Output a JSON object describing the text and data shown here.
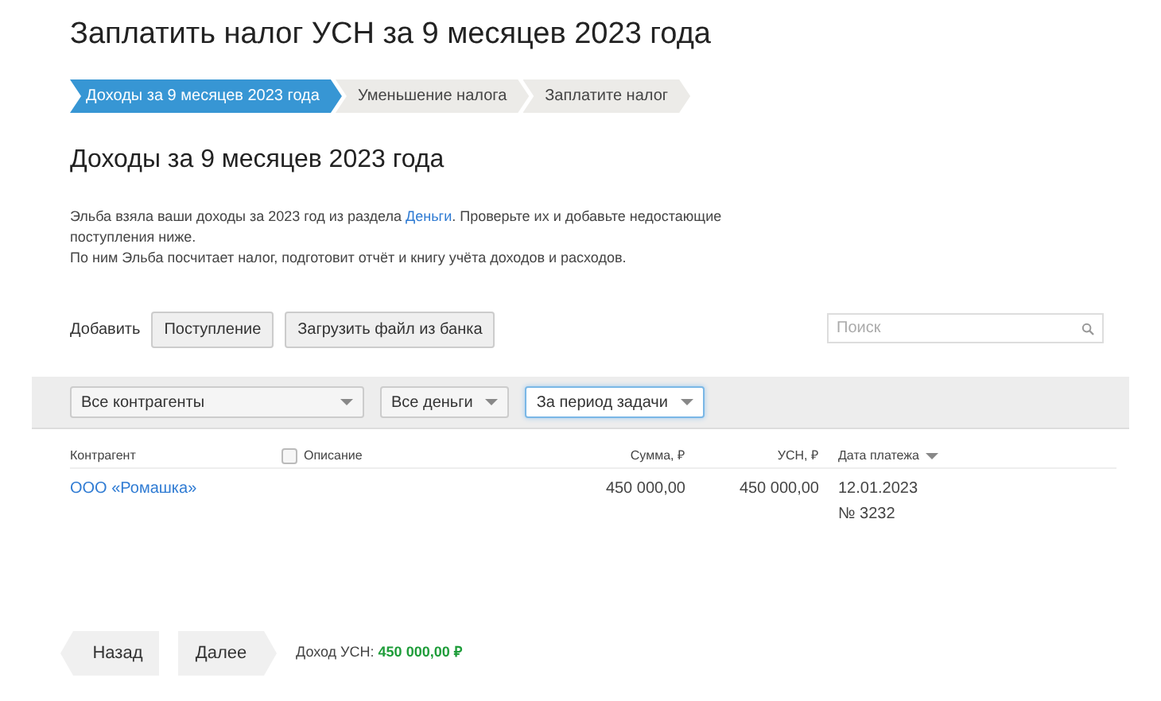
{
  "title": "Заплатить налог УСН за 9 месяцев 2023 года",
  "steps": [
    {
      "label": "Доходы за 9 месяцев 2023 года",
      "selected": true
    },
    {
      "label": "Уменьшение налога",
      "selected": false
    },
    {
      "label": "Заплатите налог",
      "selected": false
    }
  ],
  "section_title": "Доходы за 9 месяцев 2023 года",
  "intro": {
    "before_link": "Эльба взяла ваши доходы за 2023 год из раздела ",
    "link": "Деньги",
    "after_link": ". Проверьте их и добавьте недостающие поступления ниже.",
    "second_line": "По ним Эльба посчитает налог, подготовит отчёт и книгу учёта доходов и расходов."
  },
  "toolbar": {
    "label": "Добавить",
    "buttons": [
      "Поступление",
      "Загрузить файл из банка"
    ],
    "search": {
      "placeholder": "Поиск"
    }
  },
  "filters": [
    {
      "value": "Все контрагенты",
      "focused": false
    },
    {
      "value": "Все деньги",
      "focused": false
    },
    {
      "value": "За период задачи",
      "focused": true
    }
  ],
  "table": {
    "columns": [
      {
        "label": "Контрагент",
        "kind": "text"
      },
      {
        "label": "Описание",
        "kind": "checkbox",
        "checked": false
      },
      {
        "label": "Сумма, ₽",
        "kind": "number"
      },
      {
        "label": "УСН, ₽",
        "kind": "number"
      },
      {
        "label": "Дата платежа",
        "kind": "sort"
      }
    ],
    "rows": [
      {
        "counterparty": "ООО «Ромашка»",
        "amount": "450 000,00",
        "usn": "450 000,00",
        "date": "12.01.2023",
        "number": "№ 3232"
      }
    ]
  },
  "footer": {
    "back": "Назад",
    "next": "Далее",
    "total_label": "Доход УСН:",
    "total_value": "450 000,00 ₽"
  }
}
